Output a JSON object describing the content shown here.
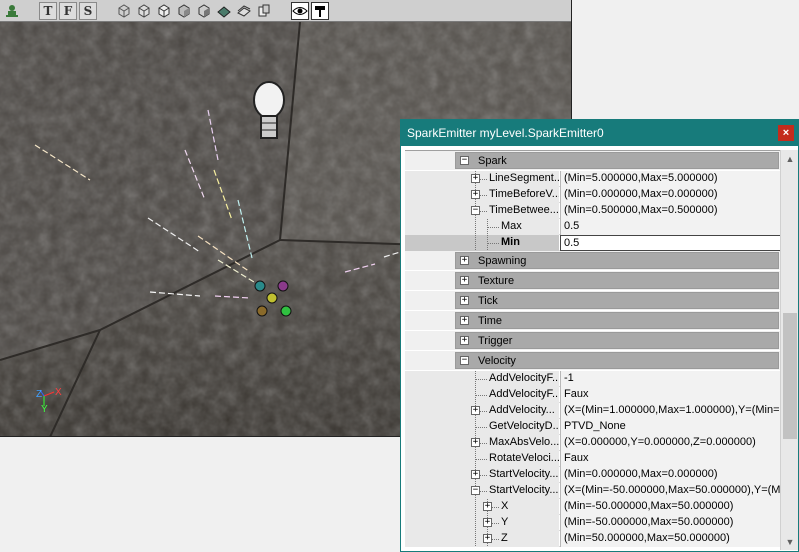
{
  "viewport": {
    "toolbar": {
      "buttons": [
        "T",
        "F",
        "S"
      ]
    },
    "axes": {
      "x": "X",
      "y": "Y",
      "z": "Z"
    }
  },
  "propwin": {
    "title": "SparkEmitter myLevel.SparkEmitter0",
    "close_glyph": "×",
    "rows": [
      {
        "kind": "cat",
        "label": "Spark",
        "expanded": true
      },
      {
        "kind": "prop",
        "name": "LineSegment...",
        "value": "(Min=5.000000,Max=5.000000)",
        "depth": 1,
        "expander": "+"
      },
      {
        "kind": "prop",
        "name": "TimeBeforeV...",
        "value": "(Min=0.000000,Max=0.000000)",
        "depth": 1,
        "expander": "+"
      },
      {
        "kind": "prop",
        "name": "TimeBetwee...",
        "value": "(Min=0.500000,Max=0.500000)",
        "depth": 1,
        "expander": "-"
      },
      {
        "kind": "prop",
        "name": "Max",
        "value": "0.5",
        "depth": 2,
        "expander": ""
      },
      {
        "kind": "prop",
        "name": "Min",
        "value": "0.5",
        "depth": 2,
        "expander": "",
        "selected": true
      },
      {
        "kind": "cat",
        "label": "Spawning",
        "expanded": false
      },
      {
        "kind": "cat",
        "label": "Texture",
        "expanded": false
      },
      {
        "kind": "cat",
        "label": "Tick",
        "expanded": false
      },
      {
        "kind": "cat",
        "label": "Time",
        "expanded": false
      },
      {
        "kind": "cat",
        "label": "Trigger",
        "expanded": false
      },
      {
        "kind": "cat",
        "label": "Velocity",
        "expanded": true
      },
      {
        "kind": "prop",
        "name": "AddVelocityF...",
        "value": "-1",
        "depth": 1,
        "expander": ""
      },
      {
        "kind": "prop",
        "name": "AddVelocityF...",
        "value": "Faux",
        "depth": 1,
        "expander": ""
      },
      {
        "kind": "prop",
        "name": "AddVelocity...",
        "value": "(X=(Min=1.000000,Max=1.000000),Y=(Min=...",
        "depth": 1,
        "expander": "+"
      },
      {
        "kind": "prop",
        "name": "GetVelocityD...",
        "value": "PTVD_None",
        "depth": 1,
        "expander": ""
      },
      {
        "kind": "prop",
        "name": "MaxAbsVelo...",
        "value": "(X=0.000000,Y=0.000000,Z=0.000000)",
        "depth": 1,
        "expander": "+"
      },
      {
        "kind": "prop",
        "name": "RotateVeloci...",
        "value": "Faux",
        "depth": 1,
        "expander": ""
      },
      {
        "kind": "prop",
        "name": "StartVelocity...",
        "value": "(Min=0.000000,Max=0.000000)",
        "depth": 1,
        "expander": "+"
      },
      {
        "kind": "prop",
        "name": "StartVelocity...",
        "value": "(X=(Min=-50.000000,Max=50.000000),Y=(Mi...",
        "depth": 1,
        "expander": "-"
      },
      {
        "kind": "prop",
        "name": "X",
        "value": "(Min=-50.000000,Max=50.000000)",
        "depth": 2,
        "expander": "+"
      },
      {
        "kind": "prop",
        "name": "Y",
        "value": "(Min=-50.000000,Max=50.000000)",
        "depth": 2,
        "expander": "+"
      },
      {
        "kind": "prop",
        "name": "Z",
        "value": "(Min=50.000000,Max=50.000000)",
        "depth": 2,
        "expander": "+"
      }
    ]
  }
}
